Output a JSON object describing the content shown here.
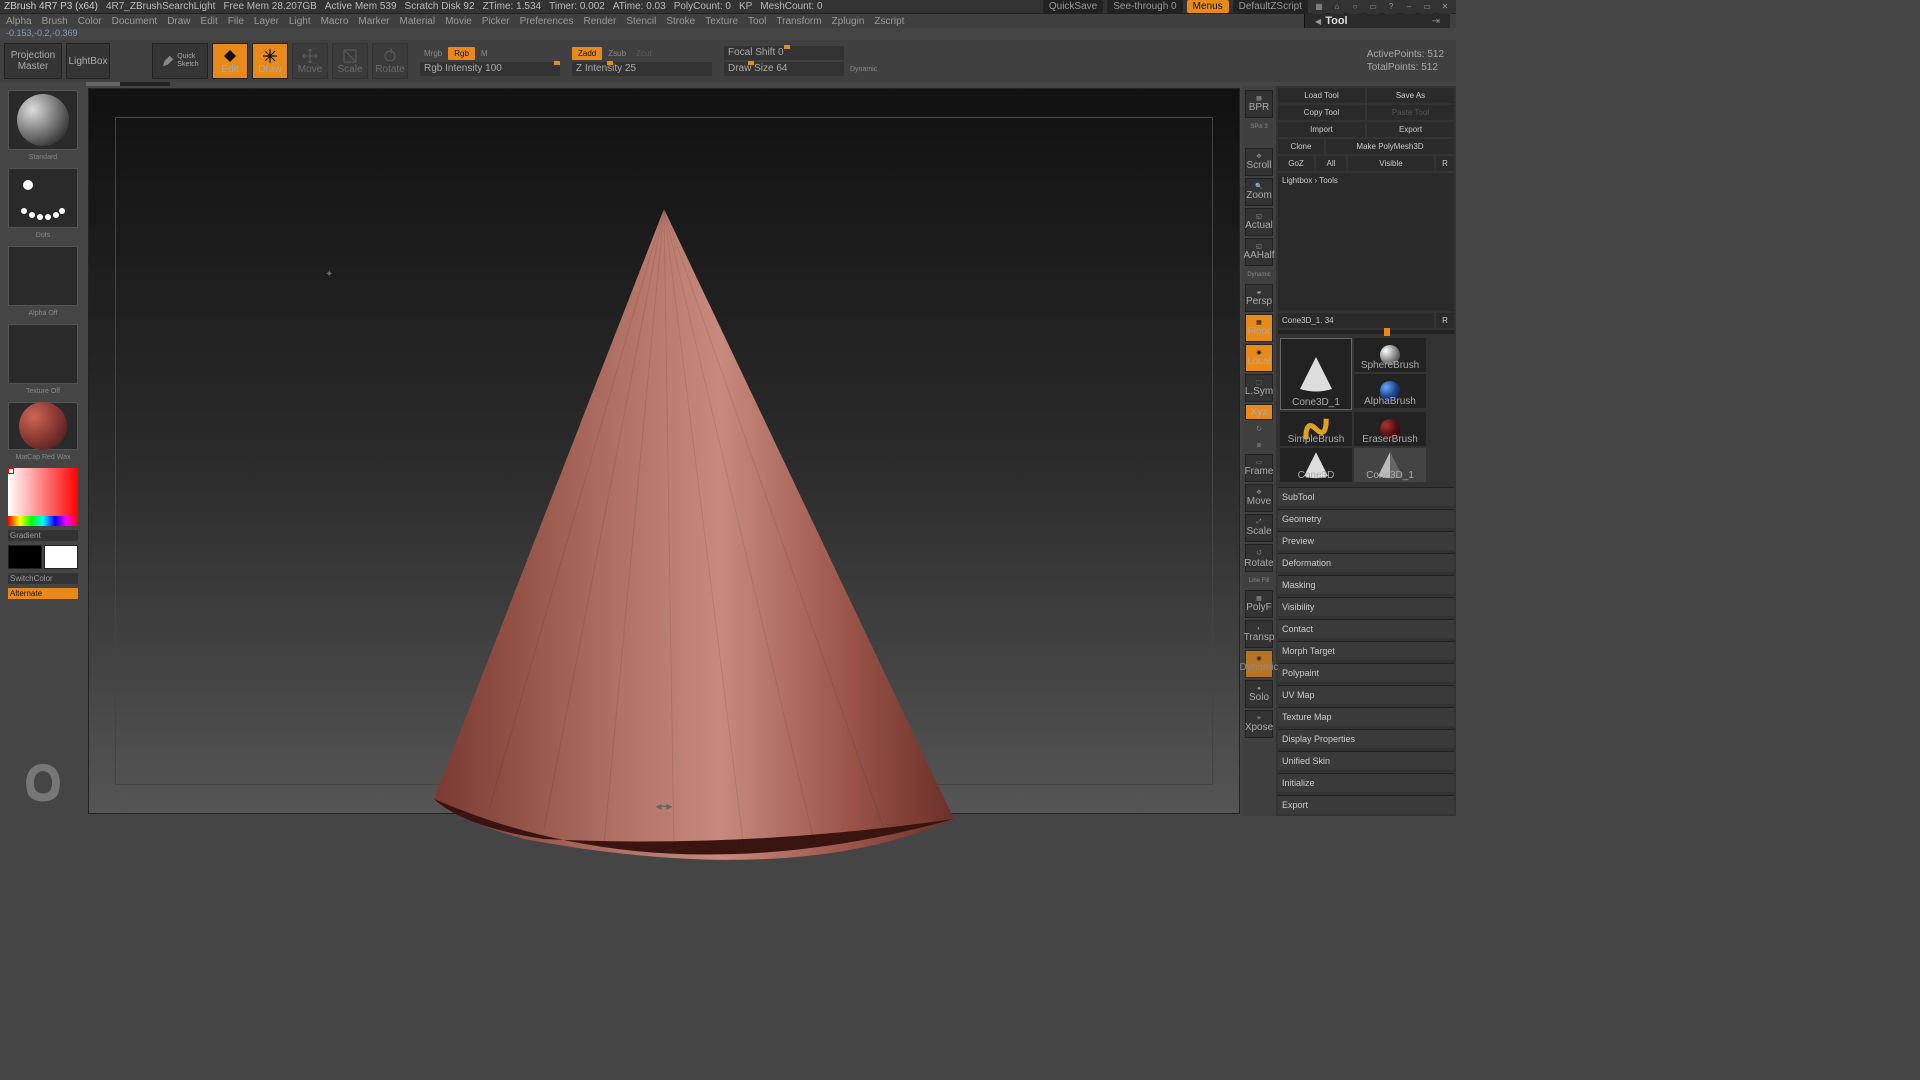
{
  "status": {
    "app": "ZBrush 4R7 P3 (x64)",
    "doc": "4R7_ZBrushSearchLight",
    "mem": "Free Mem 28.207GB",
    "active_mem": "Active Mem 539",
    "scratch": "Scratch Disk 92",
    "ztime": "ZTime: 1.534",
    "timer": "Timer: 0.002",
    "atime": "ATime: 0.03",
    "polycount": "PolyCount: 0",
    "kp": "KP",
    "meshcount": "MeshCount: 0",
    "quicksave": "QuickSave",
    "seethrough": "See-through   0",
    "menus": "Menus",
    "default_zscript": "DefaultZScript"
  },
  "menu": [
    "Alpha",
    "Brush",
    "Color",
    "Document",
    "Draw",
    "Edit",
    "File",
    "Layer",
    "Light",
    "Macro",
    "Marker",
    "Material",
    "Movie",
    "Picker",
    "Preferences",
    "Render",
    "Stencil",
    "Stroke",
    "Texture",
    "Tool",
    "Transform",
    "Zplugin",
    "Zscript"
  ],
  "panel_tab": "Tool",
  "coords": "-0.153,-0.2,-0.369",
  "shelf": {
    "projection": "Projection\nMaster",
    "lightbox": "LightBox",
    "quick_sketch": "Quick\nSketch",
    "edit": "Edit",
    "draw": "Draw",
    "move": "Move",
    "scale": "Scale",
    "rotate": "Rotate",
    "mrgb": "Mrgb",
    "rgb": "Rgb",
    "m": "M",
    "rgb_intensity": "Rgb Intensity 100",
    "zadd": "Zadd",
    "zsub": "Zsub",
    "zcut": "Zcut",
    "z_intensity": "Z Intensity 25",
    "focal_shift": "Focal Shift 0",
    "draw_size": "Draw Size 64",
    "dynamic": "Dynamic",
    "active_points": "ActivePoints: 512",
    "total_points": "TotalPoints: 512"
  },
  "left": {
    "standard": "Standard",
    "dots": "Dots",
    "alpha_off": "Alpha Off",
    "texture_off": "Texture Off",
    "matcap": "MatCap Red Wax",
    "gradient": "Gradient",
    "switch_color": "SwitchColor",
    "alternate": "Alternate"
  },
  "nav": {
    "bpr": "BPR",
    "spix": "SPix 3",
    "scroll": "Scroll",
    "zoom": "Zoom",
    "actual": "Actual",
    "aahalf": "AAHalf",
    "persp_dyn": "Dynamic",
    "persp": "Persp",
    "floor": "Floor",
    "local": "Local",
    "lsym": "L.Sym",
    "xyz": "Xyz",
    "frame": "Frame",
    "move": "Move",
    "scale": "Scale",
    "rotate": "Rotate",
    "line_fill": "Line Fill",
    "polyf": "PolyF",
    "transp": "Transp",
    "dynamic": "Dynamic",
    "solo": "Solo",
    "xpose": "Xpose"
  },
  "tool": {
    "load": "Load Tool",
    "save_as": "Save As",
    "copy": "Copy Tool",
    "paste": "Paste Tool",
    "import": "Import",
    "export": "Export",
    "clone": "Clone",
    "make": "Make PolyMesh3D",
    "goz": "GoZ",
    "all": "All",
    "visible": "Visible",
    "r_btn": "R",
    "lightbox_tools": "Lightbox › Tools",
    "current": "Cone3D_1. 34",
    "thumbs": [
      "Cone3D_1",
      "SphereBrush",
      "AlphaBrush",
      "SimpleBrush",
      "EraserBrush",
      "Cone3D",
      "Cone3D_1"
    ],
    "sections": [
      "SubTool",
      "Geometry",
      "Preview",
      "Deformation",
      "Masking",
      "Visibility",
      "Contact",
      "Morph Target",
      "Polypaint",
      "UV Map",
      "Texture Map",
      "Display Properties",
      "Unified Skin",
      "Initialize",
      "Export"
    ]
  }
}
